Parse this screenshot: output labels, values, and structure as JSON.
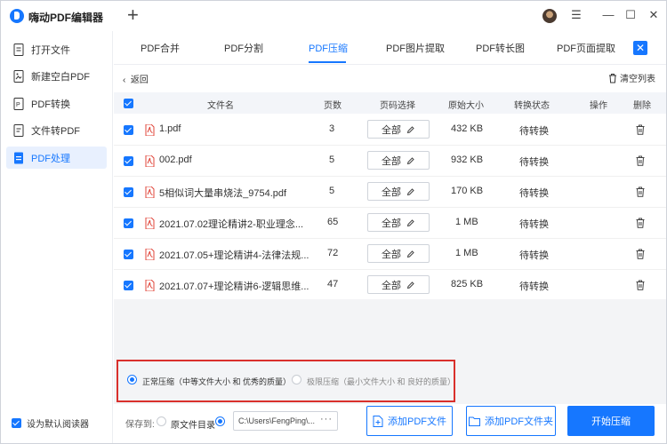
{
  "app": {
    "title": "嗨动PDF编辑器",
    "new_tab_glyph": "+"
  },
  "window_controls": {
    "menu": "☰",
    "minimize": "—",
    "maximize": "☐",
    "close": "✕"
  },
  "sidebar": {
    "items": [
      {
        "label": "打开文件",
        "icon": "file-open-icon",
        "active": false
      },
      {
        "label": "新建空白PDF",
        "icon": "image-file-icon",
        "active": false
      },
      {
        "label": "PDF转换",
        "icon": "convert-icon",
        "active": false
      },
      {
        "label": "文件转PDF",
        "icon": "file-to-pdf-icon",
        "active": false
      },
      {
        "label": "PDF处理",
        "icon": "pdf-process-icon",
        "active": true
      }
    ],
    "default_reader": {
      "label": "设为默认阅读器",
      "checked": true
    }
  },
  "tabs": [
    {
      "label": "PDF合并",
      "active": false
    },
    {
      "label": "PDF分割",
      "active": false
    },
    {
      "label": "PDF压缩",
      "active": true
    },
    {
      "label": "PDF图片提取",
      "active": false
    },
    {
      "label": "PDF转长图",
      "active": false
    },
    {
      "label": "PDF页面提取",
      "active": false
    }
  ],
  "toolbar": {
    "back": "返回",
    "clear_list": "清空列表"
  },
  "table": {
    "headers": {
      "filename": "文件名",
      "pages": "页数",
      "page_select": "页码选择",
      "original_size": "原始大小",
      "status": "转换状态",
      "action": "操作",
      "delete": "删除"
    },
    "rows": [
      {
        "name": "1.pdf",
        "pages": "3",
        "page_select": "全部",
        "size": "432 KB",
        "status": "待转换"
      },
      {
        "name": "002.pdf",
        "pages": "5",
        "page_select": "全部",
        "size": "932 KB",
        "status": "待转换"
      },
      {
        "name": "5相似词大量串烧法_9754.pdf",
        "pages": "5",
        "page_select": "全部",
        "size": "170 KB",
        "status": "待转换"
      },
      {
        "name": "2021.07.02理论精讲2-职业理念...",
        "pages": "65",
        "page_select": "全部",
        "size": "1 MB",
        "status": "待转换"
      },
      {
        "name": "2021.07.05+理论精讲4-法律法规...",
        "pages": "72",
        "page_select": "全部",
        "size": "1 MB",
        "status": "待转换"
      },
      {
        "name": "2021.07.07+理论精讲6-逻辑思维...",
        "pages": "47",
        "page_select": "全部",
        "size": "825 KB",
        "status": "待转换"
      }
    ]
  },
  "compression": {
    "normal": {
      "label": "正常压缩（中等文件大小 和 优秀的质量）",
      "selected": true
    },
    "extreme": {
      "label": "极限压缩（最小文件大小 和 良好的质量）",
      "selected": false
    }
  },
  "bottom": {
    "save_to": "保存到:",
    "option_source": "原文件目录",
    "path": "C:\\Users\\FengPing\\...",
    "path_more": "···",
    "add_pdf": "添加PDF文件",
    "add_folder": "添加PDF文件夹",
    "start": "开始压缩"
  },
  "colors": {
    "accent": "#1677ff",
    "highlight_border": "#d9302c",
    "pdf_red": "#e0453a"
  }
}
